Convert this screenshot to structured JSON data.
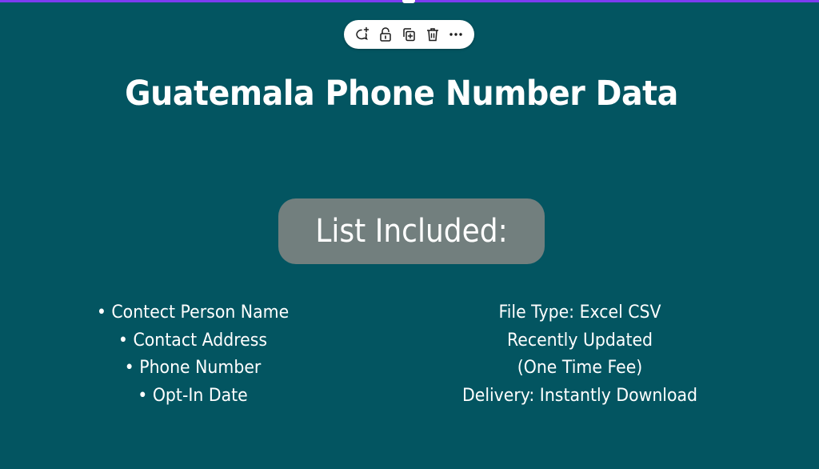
{
  "selection": {
    "border_color": "#7d3cf0"
  },
  "toolbar": {
    "items": [
      {
        "name": "add-comment",
        "icon": "comment-plus-icon",
        "label": "Comment"
      },
      {
        "name": "lock",
        "icon": "unlock-icon",
        "label": "Lock"
      },
      {
        "name": "duplicate",
        "icon": "duplicate-icon",
        "label": "Duplicate"
      },
      {
        "name": "delete",
        "icon": "trash-icon",
        "label": "Delete"
      },
      {
        "name": "more",
        "icon": "more-icon",
        "label": "More"
      }
    ]
  },
  "page": {
    "background": "#035561",
    "title": "Guatemala Phone Number Data",
    "pill_label": "List Included:",
    "pill_color": "#727f7e",
    "list_left": [
      "• Contect Person Name",
      "• Contact Address",
      "• Phone Number",
      "• Opt-In Date"
    ],
    "list_right": [
      "File Type: Excel CSV",
      "Recently Updated",
      "(One Time Fee)",
      "Delivery: Instantly Download"
    ]
  }
}
